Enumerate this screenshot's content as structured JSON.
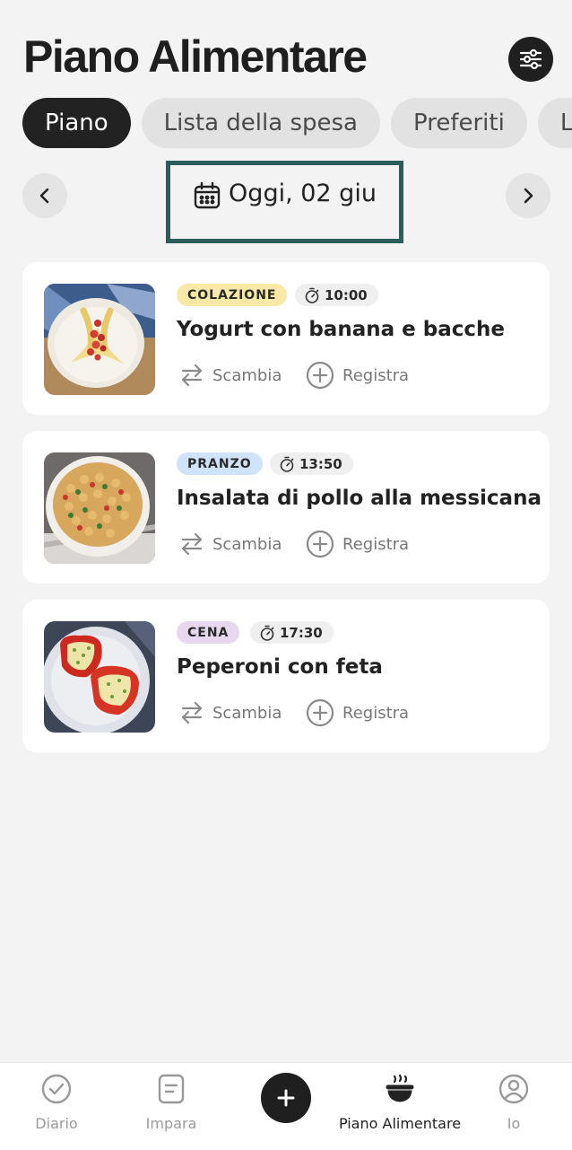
{
  "header": {
    "title": "Piano Alimentare",
    "filter_icon": "sliders-icon"
  },
  "tabs": [
    {
      "label": "Piano",
      "active": true
    },
    {
      "label": "Lista della spesa",
      "active": false
    },
    {
      "label": "Preferiti",
      "active": false
    },
    {
      "label": "L",
      "active": false
    }
  ],
  "date_nav": {
    "label": "Oggi, 02 giu",
    "prev_icon": "chevron-left-icon",
    "next_icon": "chevron-right-icon",
    "calendar_icon": "calendar-icon"
  },
  "meals": [
    {
      "badge": "COLAZIONE",
      "badge_color": "#f9e8a6",
      "time": "10:00",
      "title": "Yogurt con banana e bacche",
      "swap_label": "Scambia",
      "log_label": "Registra"
    },
    {
      "badge": "PRANZO",
      "badge_color": "#cfe3fb",
      "time": "13:50",
      "title": "Insalata di pollo alla messicana",
      "swap_label": "Scambia",
      "log_label": "Registra"
    },
    {
      "badge": "CENA",
      "badge_color": "#e7d8ef",
      "time": "17:30",
      "title": "Peperoni con feta",
      "swap_label": "Scambia",
      "log_label": "Registra"
    }
  ],
  "bottom_nav": {
    "items": [
      {
        "label": "Diario",
        "icon": "check-circle-icon"
      },
      {
        "label": "Impara",
        "icon": "document-icon"
      },
      {
        "label": "",
        "icon": "plus-icon"
      },
      {
        "label": "Piano Alimentare",
        "icon": "bowl-icon",
        "active": true
      },
      {
        "label": "Io",
        "icon": "profile-icon"
      }
    ]
  },
  "colors": {
    "accent_dark": "#1f1f1f",
    "focus_border": "#2b5e5a",
    "background": "#f3f3f3"
  }
}
